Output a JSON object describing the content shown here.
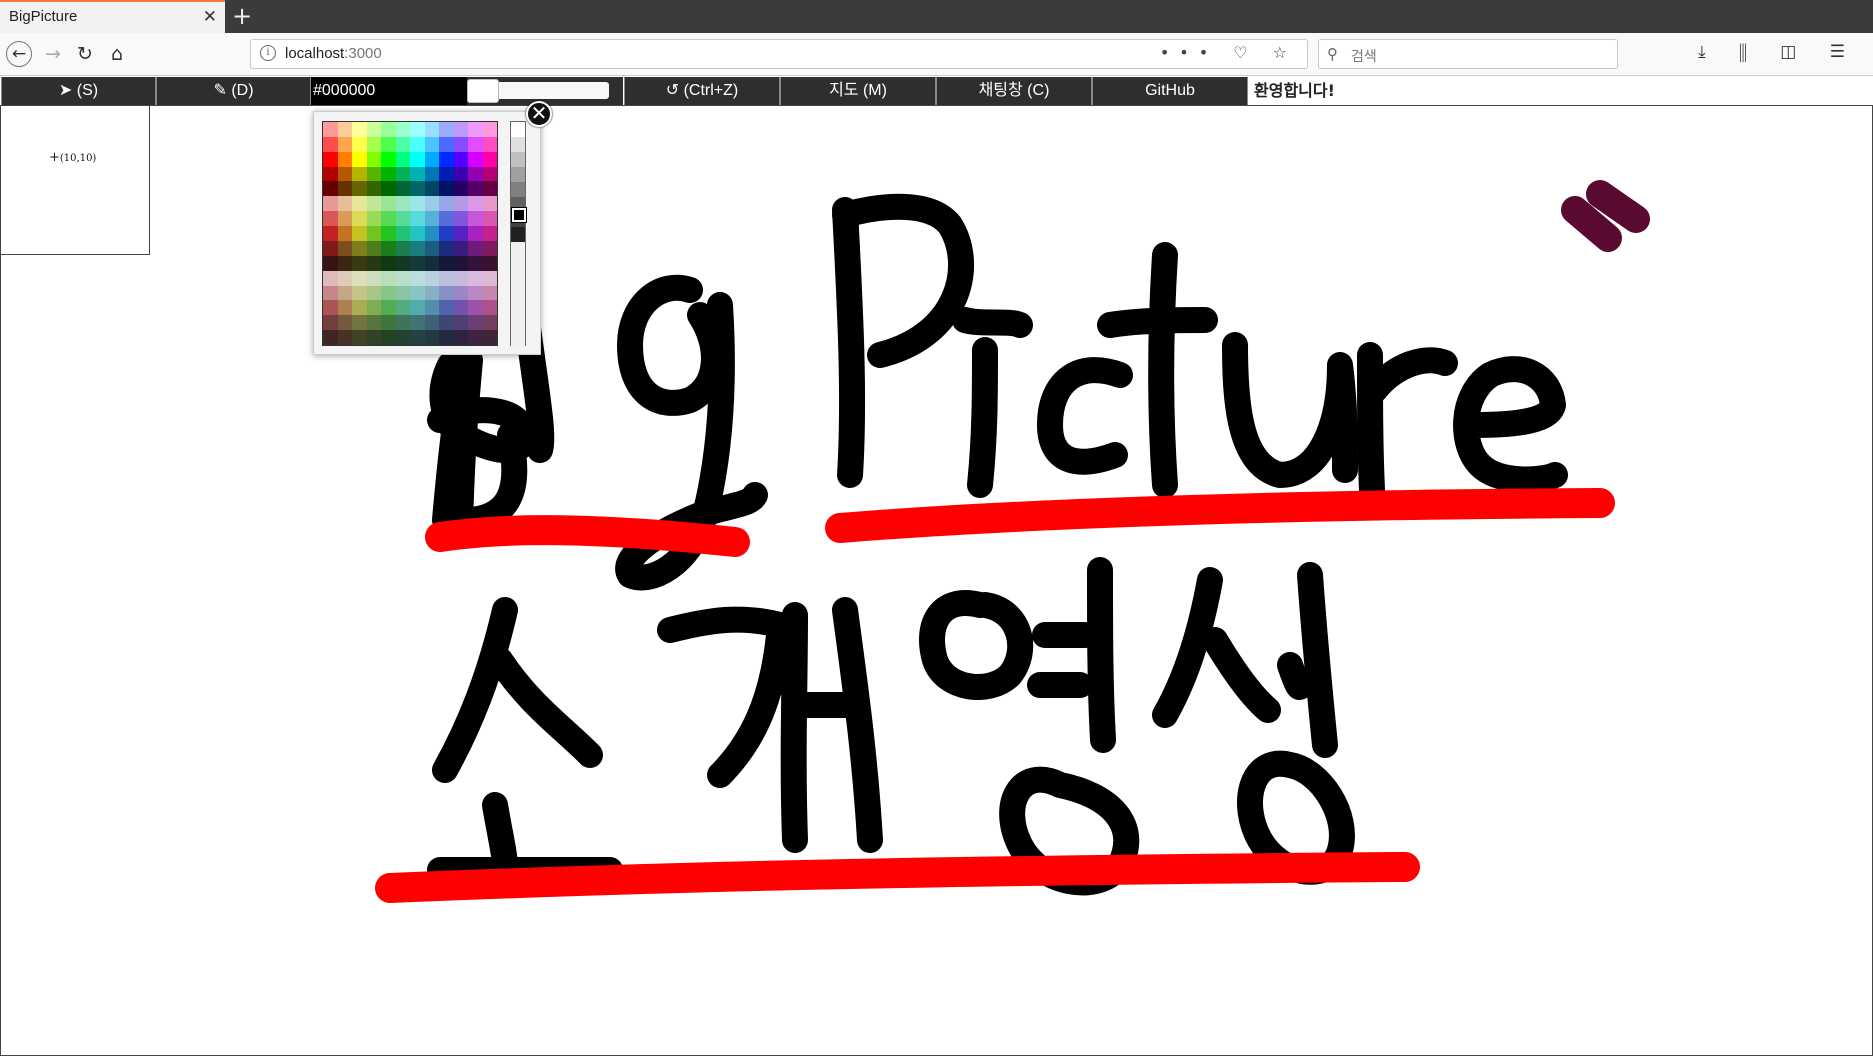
{
  "browser": {
    "tab_title": "BigPicture",
    "tab_close": "✕",
    "new_tab": "+",
    "url_host": "localhost",
    "url_port": ":3000",
    "url_icons": "••• ♡ ☆",
    "search_placeholder": "검색",
    "right_icons": "⤓ ⫼ ◫ ☰"
  },
  "toolbar": {
    "select_label": "(S)",
    "draw_label": "(D)",
    "color_value": "#000000",
    "undo_label": "(Ctrl+Z)",
    "map_label": "지도 (M)",
    "chat_label": "채팅창 (C)",
    "github_label": "GitHub",
    "welcome": "환영합니다!"
  },
  "minimap": {
    "coord": "(10,10)"
  },
  "picker": {
    "close": "✕",
    "selected": "#000000"
  },
  "colors": {
    "toolbar_bg": "#2e2e2e",
    "stroke_black": "#000000",
    "stroke_red": "#ff0000",
    "stroke_maroon": "#5a0a30"
  }
}
